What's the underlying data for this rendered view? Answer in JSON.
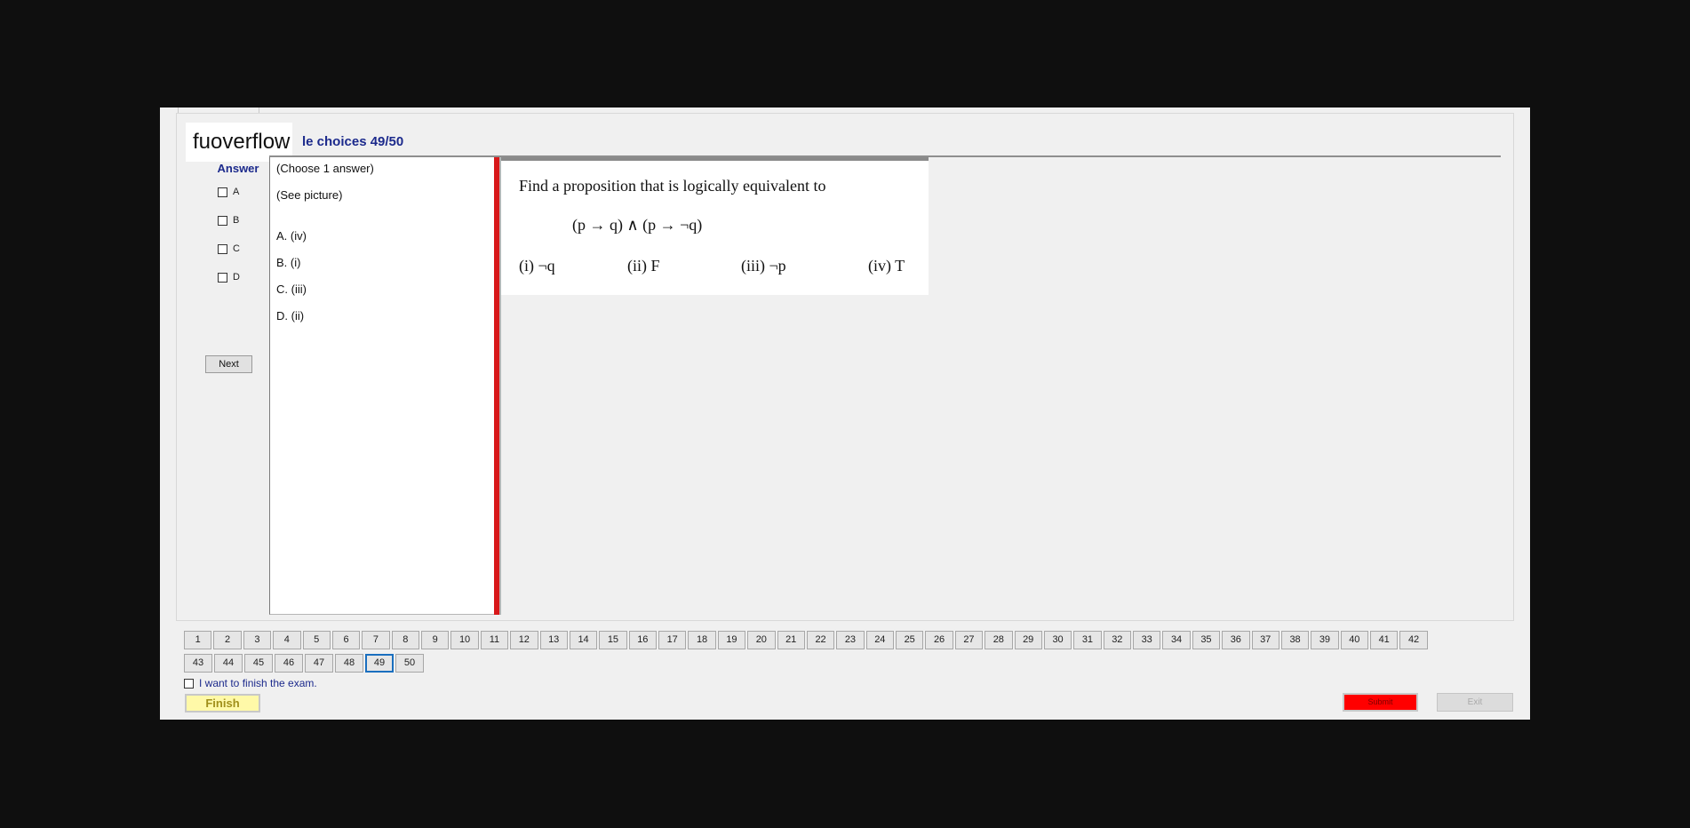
{
  "brand": "fuoverflow",
  "heading": "le choices 49/50",
  "answer_panel": {
    "title": "Answer",
    "options": [
      "A",
      "B",
      "C",
      "D"
    ],
    "next_label": "Next"
  },
  "answer_text": {
    "instruction": "(Choose 1 answer)",
    "see_picture": "(See picture)",
    "choices": [
      "A.  (iv)",
      "B.  (i)",
      "C.  (iii)",
      "D.  (ii)"
    ]
  },
  "question": {
    "text": "Find a proposition that is logically equivalent to",
    "formula": "(p → q) ∧ (p → ¬q)",
    "choices": [
      "(i) ¬q",
      "(ii) F",
      "(iii) ¬p",
      "(iv) T"
    ]
  },
  "navigation": {
    "row1": [
      "1",
      "2",
      "3",
      "4",
      "5",
      "6",
      "7",
      "8",
      "9",
      "10",
      "11",
      "12",
      "13",
      "14",
      "15",
      "16",
      "17",
      "18",
      "19",
      "20",
      "21",
      "22",
      "23",
      "24",
      "25",
      "26",
      "27",
      "28",
      "29",
      "30",
      "31",
      "32",
      "33",
      "34",
      "35",
      "36",
      "37",
      "38",
      "39",
      "40",
      "41",
      "42"
    ],
    "row2": [
      "43",
      "44",
      "45",
      "46",
      "47",
      "48",
      "49",
      "50"
    ],
    "current": "49"
  },
  "footer": {
    "finish_check_label": "I want to finish the exam.",
    "finish_label": "Finish",
    "submit_label": "Submit",
    "exit_label": "Exit"
  },
  "colors": {
    "accent_blue": "#1c2a8c",
    "red_bar": "#d8181a",
    "submit_red": "#ff0000",
    "finish_yellow": "#fff9a8",
    "current_border": "#1a6fbf"
  }
}
